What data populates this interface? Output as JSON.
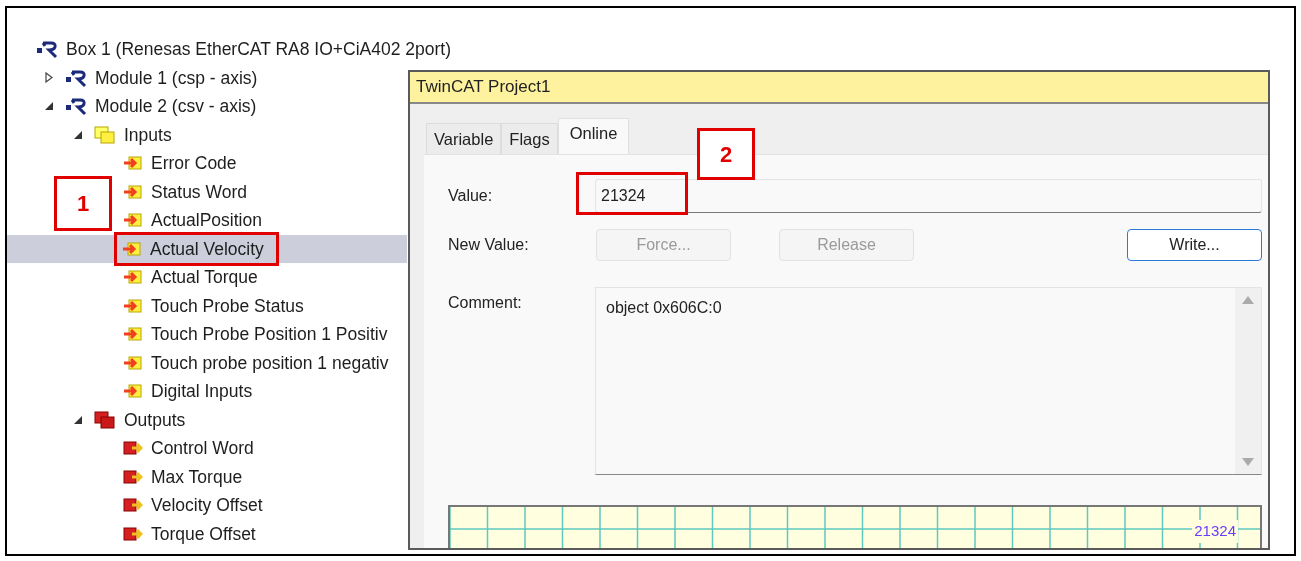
{
  "tree": [
    {
      "label": "Box 1 (Renesas EtherCAT RA8 IO+CiA402 2port)",
      "kind": "device",
      "selected": false,
      "children": [
        {
          "label": "Module 1 (csp - axis)",
          "kind": "device",
          "expanded": false,
          "selected": false
        },
        {
          "label": "Module 2 (csv - axis)",
          "kind": "device",
          "expanded": true,
          "selected": false,
          "children": [
            {
              "label": "Inputs",
              "kind": "input-group",
              "expanded": true,
              "selected": false,
              "children": [
                {
                  "label": "Error Code",
                  "kind": "input",
                  "selected": false,
                  "highlighted": false
                },
                {
                  "label": "Status Word",
                  "kind": "input",
                  "selected": false,
                  "highlighted": false
                },
                {
                  "label": "ActualPosition",
                  "kind": "input",
                  "selected": false,
                  "highlighted": false
                },
                {
                  "label": "Actual Velocity",
                  "kind": "input",
                  "selected": true,
                  "highlighted": true
                },
                {
                  "label": "Actual Torque",
                  "kind": "input",
                  "selected": false,
                  "highlighted": false
                },
                {
                  "label": "Touch Probe Status",
                  "kind": "input",
                  "selected": false,
                  "highlighted": false
                },
                {
                  "label": "Touch Probe Position 1 Positiv",
                  "kind": "input",
                  "selected": false,
                  "highlighted": false
                },
                {
                  "label": "Touch probe position 1 negativ",
                  "kind": "input",
                  "selected": false,
                  "highlighted": false
                },
                {
                  "label": "Digital Inputs",
                  "kind": "input",
                  "selected": false,
                  "highlighted": false
                }
              ]
            },
            {
              "label": "Outputs",
              "kind": "output-group",
              "expanded": true,
              "selected": false,
              "children": [
                {
                  "label": "Control Word",
                  "kind": "output",
                  "selected": false,
                  "highlighted": false
                },
                {
                  "label": "Max Torque",
                  "kind": "output",
                  "selected": false,
                  "highlighted": false
                },
                {
                  "label": "Velocity Offset",
                  "kind": "output",
                  "selected": false,
                  "highlighted": false
                },
                {
                  "label": "Torque Offset",
                  "kind": "output",
                  "selected": false,
                  "highlighted": false
                }
              ]
            }
          ]
        }
      ]
    }
  ],
  "dialog": {
    "title": "TwinCAT Project1",
    "tabs": [
      {
        "label": "Variable",
        "selected": false
      },
      {
        "label": "Flags",
        "selected": false
      },
      {
        "label": "Online",
        "selected": true
      }
    ],
    "value_label": "Value:",
    "value": "21324",
    "value_highlighted": true,
    "new_value_label": "New Value:",
    "buttons": [
      {
        "label": "Force...",
        "disabled": true
      },
      {
        "label": "Release",
        "disabled": true
      },
      {
        "label": "Write...",
        "disabled": false
      }
    ],
    "comment_label": "Comment:",
    "comment": "object 0x606C:0",
    "plot_label": "21324"
  },
  "callouts": [
    {
      "label": "1"
    },
    {
      "label": "2"
    }
  ]
}
